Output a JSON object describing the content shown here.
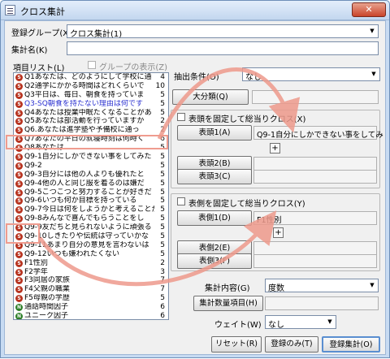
{
  "window": {
    "title": "クロス集計",
    "close_symbol": "✕"
  },
  "group_label": "登録グループ(X)",
  "group_value": "クロス集計(1)",
  "name_label": "集計名(K)",
  "name_value": "",
  "items_label": "項目リスト(L)",
  "group_view_label": "グループの表示(Z)",
  "filter_label": "抽出条件(O)",
  "filter_value": "なし",
  "major_button": "大分類(Q)",
  "major_value": "",
  "head_group_label": "表頭を固定して総当りクロス(X)",
  "head1_button": "表頭1(A)",
  "head1_value": "Q9-1自分にしかできない事をしてみ",
  "head2_button": "表頭2(B)",
  "head2_value": "",
  "head3_button": "表頭3(C)",
  "head3_value": "",
  "side_group_label": "表側を固定して総当りクロス(Y)",
  "side1_button": "表側1(D)",
  "side1_value": "F1性別",
  "side2_button": "表側2(E)",
  "side2_value": "",
  "side3_button": "表側3(F)",
  "side3_value": "",
  "plus_symbol": "+",
  "calc_label": "集計内容(G)",
  "calc_value": "度数",
  "count_button": "集計数量項目(H)",
  "count_value": "",
  "weight_label": "ウェイト(W)",
  "weight_value": "なし",
  "reset_button": "リセット(R)",
  "register_only_button": "登録のみ(T)",
  "register_calc_button": "登録集計(O)",
  "items": [
    {
      "icon": "S",
      "text": "Q1あなたは、どのようにして学校に通",
      "count": "4"
    },
    {
      "icon": "S",
      "text": "Q2通学にかかる時間はどれくらいで",
      "count": "10"
    },
    {
      "icon": "S",
      "text": "Q3平日は、毎日、朝食を持っていま",
      "count": "5"
    },
    {
      "icon": "S",
      "text": "Q3-SQ朝食を持たない理由は何です",
      "count": "5"
    },
    {
      "icon": "S",
      "text": "Q4あなたは授業中眠たくなることがあ",
      "count": "5"
    },
    {
      "icon": "S",
      "text": "Q5あなたは部活動を行っていますか",
      "count": "2"
    },
    {
      "icon": "S",
      "text": "Q6.あなたは進学塾や予備校に通っ",
      "count": "2"
    },
    {
      "icon": "S",
      "text": "Q7あなたの平日の就寝時刻は何時く",
      "count": "6"
    },
    {
      "icon": "S",
      "text": "Q8あなたは",
      "count": "5"
    },
    {
      "icon": "S",
      "text": "Q9-1自分にしかできない事をしてみた",
      "count": "5"
    },
    {
      "icon": "S",
      "text": "Q9-2",
      "count": "5"
    },
    {
      "icon": "S",
      "text": "Q9-3自分には他の人よりも優れたと",
      "count": "5"
    },
    {
      "icon": "S",
      "text": "Q9-4他の人と同じ服を着るのは嫌だ",
      "count": "5"
    },
    {
      "icon": "S",
      "text": "Q9-5こつこつと努力することが好きだ",
      "count": "5"
    },
    {
      "icon": "S",
      "text": "Q9-6いつも何か目標を持っている",
      "count": "5"
    },
    {
      "icon": "S",
      "text": "Q9-7今日は何をしようかと考えることが",
      "count": "5"
    },
    {
      "icon": "S",
      "text": "Q9-8みんなで喜んでもらうことをし",
      "count": "5"
    },
    {
      "icon": "S",
      "text": "Q9-9友だちと見られないように頑張る",
      "count": "5"
    },
    {
      "icon": "S",
      "text": "Q9-10しきたりや伝統は守っていかな",
      "count": "5"
    },
    {
      "icon": "S",
      "text": "Q9-11あまり自分の意見を言わないは",
      "count": "5"
    },
    {
      "icon": "S",
      "text": "Q9-12いつも嫌われたくない",
      "count": "5"
    },
    {
      "icon": "S",
      "text": "F1性別",
      "count": "2"
    },
    {
      "icon": "S",
      "text": "F2学年",
      "count": "3"
    },
    {
      "icon": "S",
      "text": "F3同居の家族",
      "count": "7"
    },
    {
      "icon": "S",
      "text": "F4父親の職業",
      "count": "7"
    },
    {
      "icon": "S",
      "text": "F5母親の学歴",
      "count": "5"
    },
    {
      "icon": "N",
      "text": "通話時間因子",
      "count": "6"
    },
    {
      "icon": "N",
      "text": "ユニーク因子",
      "count": "6"
    },
    {
      "icon": "N",
      "text": "目標達成因子",
      "count": "11"
    },
    {
      "icon": "S",
      "text": "タイプ分類",
      "count": "6"
    }
  ]
}
